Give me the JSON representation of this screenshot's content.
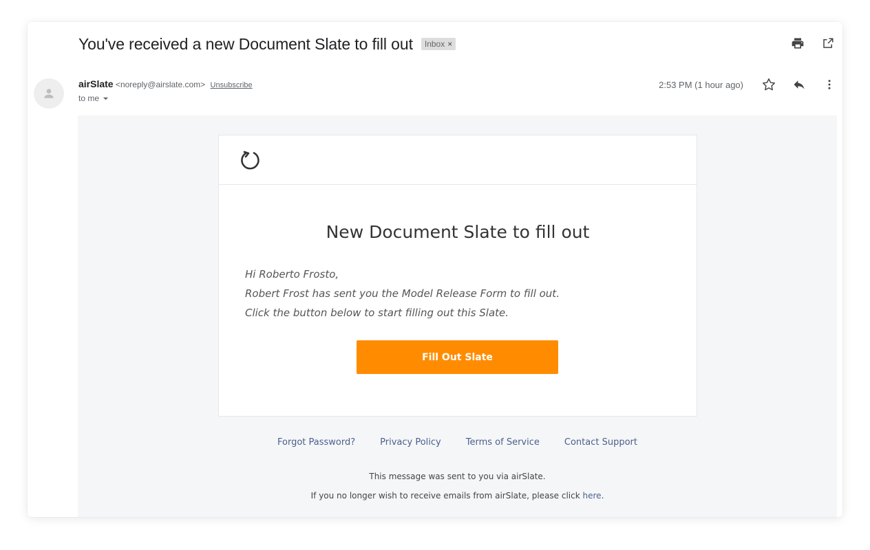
{
  "email": {
    "subject": "You've received a new Document Slate to fill out",
    "label": "Inbox",
    "label_close": "×",
    "sender_name": "airSlate",
    "sender_address": "<noreply@airslate.com>",
    "unsubscribe": "Unsubscribe",
    "recipient": "to me",
    "timestamp": "2:53 PM (1 hour ago)"
  },
  "icons": {
    "print": "print-icon",
    "open_new_window": "open-in-new-window-icon",
    "avatar": "person-icon",
    "star": "star-icon",
    "reply": "reply-icon",
    "more": "more-vertical-icon",
    "recipient_dropdown": "caret-down-icon",
    "brand_logo": "airslate-logo-icon"
  },
  "message": {
    "title": "New Document Slate to fill out",
    "greeting": "Hi Roberto Frosto,",
    "line_1": "Robert Frost has sent you the Model Release Form to fill out.",
    "line_2": "Click the button below to start filling out this Slate.",
    "button_label": "Fill Out Slate"
  },
  "footer": {
    "links": [
      "Forgot Password?",
      "Privacy Policy",
      "Terms of Service",
      "Contact Support"
    ],
    "note_1": "This message was sent to you via airSlate.",
    "note_2_prefix": "If you no longer wish to receive emails from airSlate, please click",
    "note_2_link": "here",
    "note_2_suffix": "."
  },
  "colors": {
    "button": "#ff8c00",
    "body_background": "#f5f6f8",
    "footer_link": "#4a5f8c"
  }
}
